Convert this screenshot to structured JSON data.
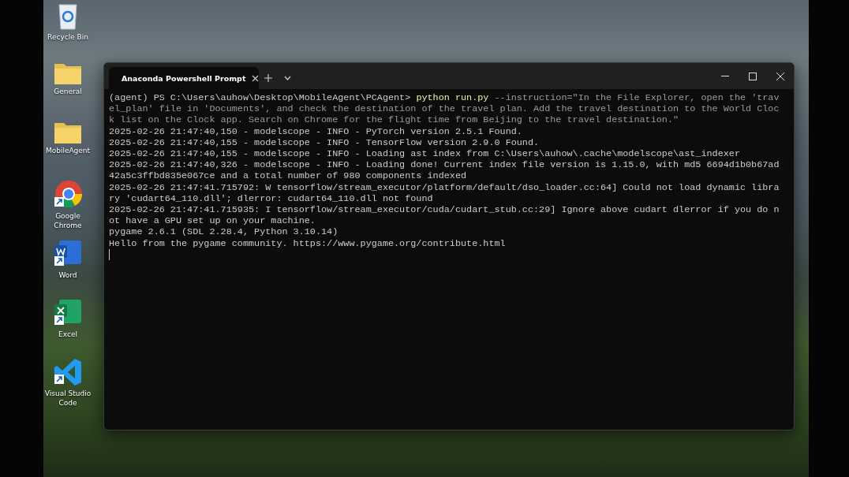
{
  "desktop_icons": [
    {
      "kind": "recycle",
      "label": "Recycle Bin"
    },
    {
      "kind": "folder",
      "label": "General"
    },
    {
      "kind": "folder",
      "label": "MobileAgent"
    },
    {
      "kind": "chrome",
      "label": "Google Chrome"
    },
    {
      "kind": "word",
      "label": "Word"
    },
    {
      "kind": "excel",
      "label": "Excel"
    },
    {
      "kind": "vscode",
      "label": "Visual Studio Code"
    }
  ],
  "window": {
    "tabs": [
      {
        "title": "Anaconda Powershell Prompt",
        "selected": true
      }
    ]
  },
  "terminal": {
    "lines": [
      {
        "segments": [
          {
            "text": "(agent) PS C:\\Users\\auhow\\Desktop\\MobileAgent\\PCAgent> ",
            "kind": "normal"
          },
          {
            "text": "python run.py",
            "kind": "bright"
          },
          {
            "text": " --instruction=\"In the File Explorer, open the 'trav",
            "kind": "dim"
          }
        ]
      },
      {
        "segments": [
          {
            "text": "el_plan' file in 'Documents', and check the destination of the travel plan. Add the travel destination to the World Cloc",
            "kind": "dim"
          }
        ]
      },
      {
        "segments": [
          {
            "text": "k list on the Clock app. Search on Chrome for the flight time from Beijing to the travel destination.\"",
            "kind": "dim"
          }
        ]
      },
      {
        "segments": [
          {
            "text": "2025-02-26 21:47:40,150 - modelscope - INFO - PyTorch version 2.5.1 Found.",
            "kind": "normal"
          }
        ]
      },
      {
        "segments": [
          {
            "text": "2025-02-26 21:47:40,155 - modelscope - INFO - TensorFlow version 2.9.0 Found.",
            "kind": "normal"
          }
        ]
      },
      {
        "segments": [
          {
            "text": "2025-02-26 21:47:40,155 - modelscope - INFO - Loading ast index from C:\\Users\\auhow\\.cache\\modelscope\\ast_indexer",
            "kind": "normal"
          }
        ]
      },
      {
        "segments": [
          {
            "text": "2025-02-26 21:47:40,326 - modelscope - INFO - Loading done! Current index file version is 1.15.0, with md5 6694d1b0b67ad",
            "kind": "normal"
          }
        ]
      },
      {
        "segments": [
          {
            "text": "42a5c3ffbd835e067ce and a total number of 980 components indexed",
            "kind": "normal"
          }
        ]
      },
      {
        "segments": [
          {
            "text": "2025-02-26 21:47:41.715792: W tensorflow/stream_executor/platform/default/dso_loader.cc:64] Could not load dynamic libra",
            "kind": "normal"
          }
        ]
      },
      {
        "segments": [
          {
            "text": "ry 'cudart64_110.dll'; dlerror: cudart64_110.dll not found",
            "kind": "normal"
          }
        ]
      },
      {
        "segments": [
          {
            "text": "2025-02-26 21:47:41.715935: I tensorflow/stream_executor/cuda/cudart_stub.cc:29] Ignore above cudart dlerror if you do n",
            "kind": "normal"
          }
        ]
      },
      {
        "segments": [
          {
            "text": "ot have a GPU set up on your machine.",
            "kind": "normal"
          }
        ]
      },
      {
        "segments": [
          {
            "text": "pygame 2.6.1 (SDL 2.28.4, Python 3.10.14)",
            "kind": "normal"
          }
        ]
      },
      {
        "segments": [
          {
            "text": "Hello from the pygame community. https://www.pygame.org/contribute.html",
            "kind": "normal"
          }
        ]
      }
    ]
  }
}
